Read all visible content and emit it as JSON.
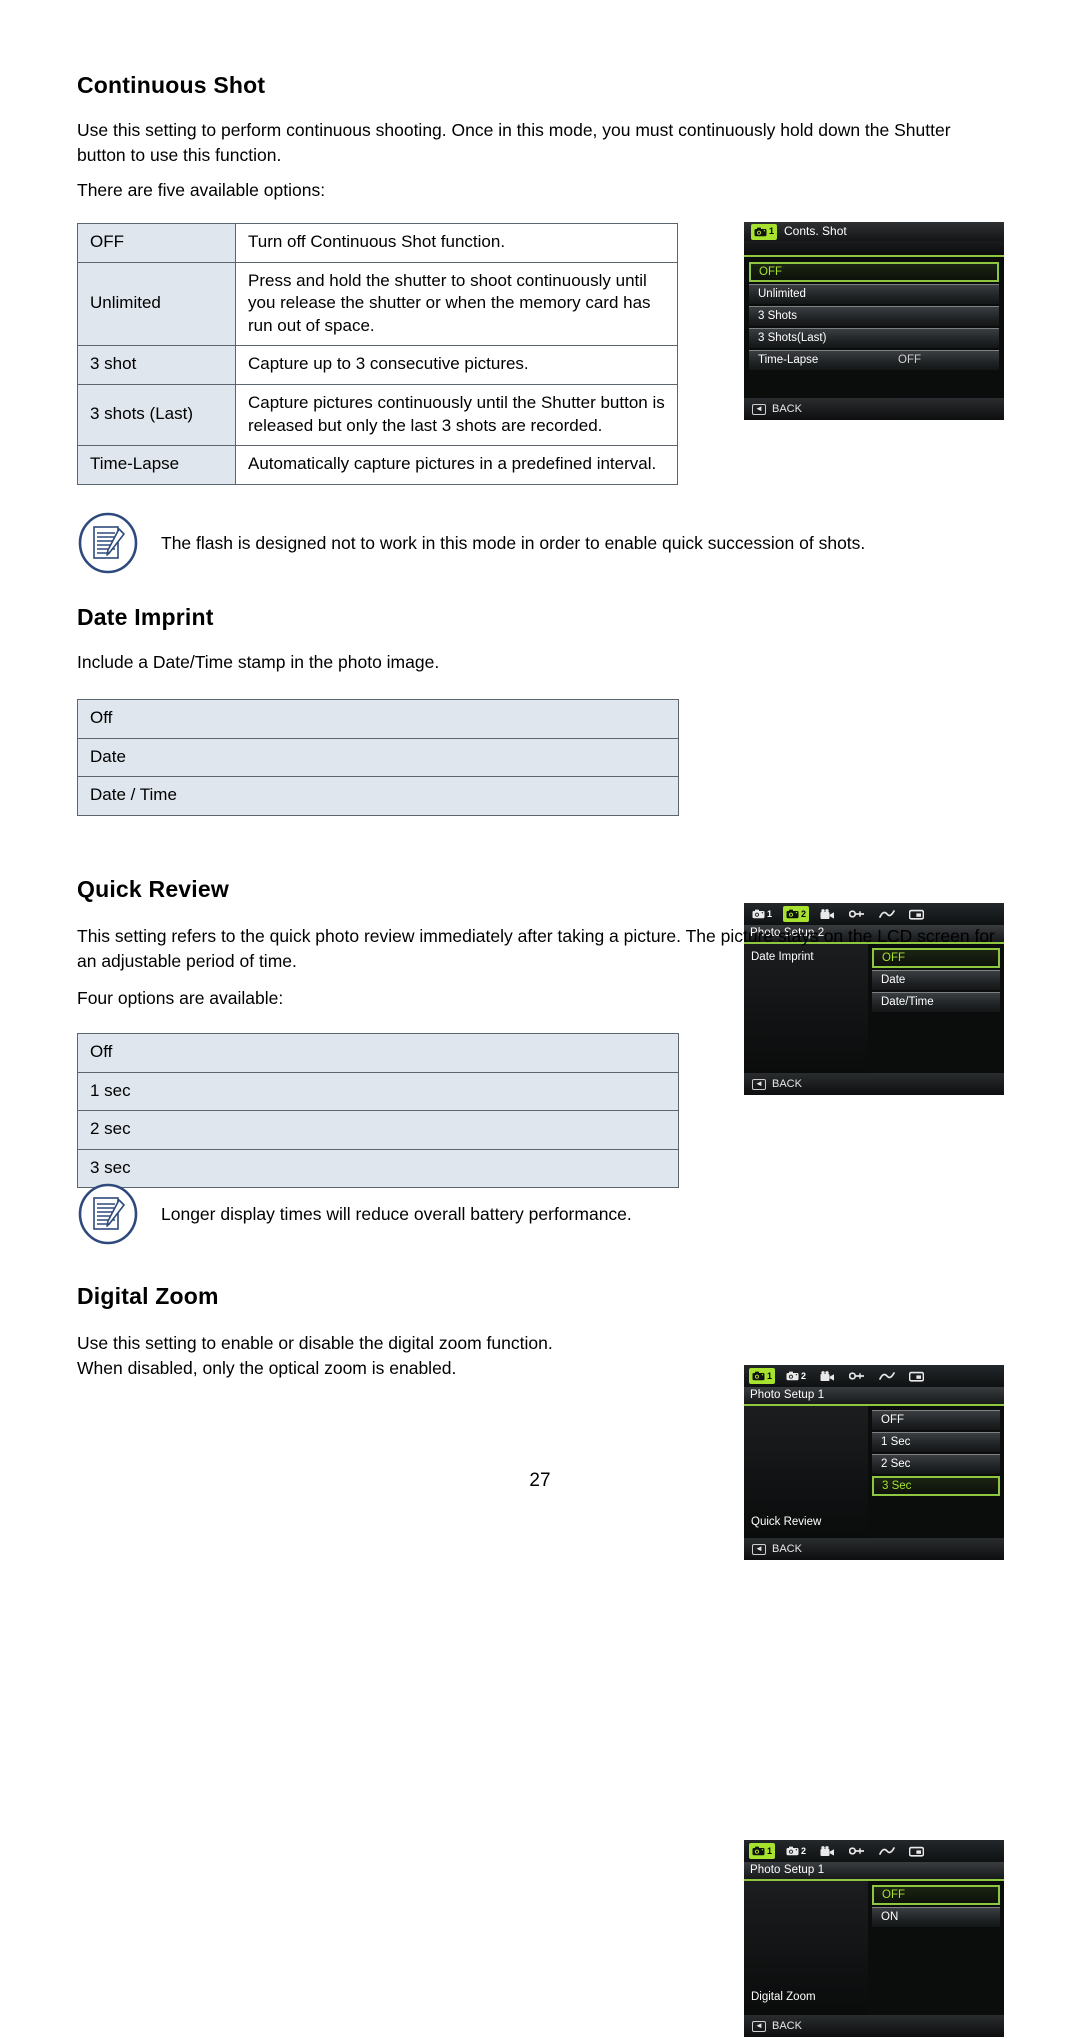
{
  "page": {
    "number": "27"
  },
  "sections": {
    "continuous_shot": {
      "title": "Continuous Shot",
      "paragraph1": "Use this setting to perform continuous shooting. Once in this mode, you must continuously hold down the Shutter button to use this function.",
      "paragraph2": "There are five available options:",
      "table": {
        "rows": [
          {
            "key": "OFF",
            "value": "Turn off Continuous Shot function."
          },
          {
            "key": "Unlimited",
            "value": "Press and hold the shutter to shoot continuously until you release the shutter or when the memory card has run out of space."
          },
          {
            "key": "3 shot",
            "value": "Capture up to 3 consecutive pictures."
          },
          {
            "key": "3 shots (Last)",
            "value": "Capture pictures continuously until the Shutter button is released but only the last 3 shots are recorded."
          },
          {
            "key": "Time-Lapse",
            "value": "Automatically capture pictures in a predefined interval."
          }
        ]
      },
      "note": "The flash is designed not to work in this mode in order to enable quick succession of shots."
    },
    "date_imprint": {
      "title": "Date Imprint",
      "paragraph1": "Include a Date/Time stamp in the photo image.",
      "table": {
        "rows": [
          "Off",
          "Date",
          "Date / Time"
        ]
      }
    },
    "quick_review": {
      "title": "Quick Review",
      "paragraph1": "This setting refers to the quick photo review immediately after taking a picture. The picture stays on the LCD screen for an adjustable period of time.",
      "paragraph2": "Four options are available:",
      "table": {
        "rows": [
          "Off",
          "1 sec",
          "2 sec",
          "3 sec"
        ]
      },
      "note": "Longer display times will reduce overall battery performance."
    },
    "digital_zoom": {
      "title": "Digital Zoom",
      "paragraph1": "Use this setting to enable or disable the digital zoom function.\nWhen disabled, only the optical zoom is enabled."
    }
  },
  "lcd_screens": {
    "conts_shot": {
      "header_tab_number": "1",
      "header_title": "Conts. Shot",
      "back_label": "BACK",
      "options": [
        {
          "label": "OFF",
          "selected": true,
          "tail": ""
        },
        {
          "label": "Unlimited",
          "selected": false,
          "tail": ""
        },
        {
          "label": "3 Shots",
          "selected": false,
          "tail": ""
        },
        {
          "label": "3 Shots(Last)",
          "selected": false,
          "tail": ""
        },
        {
          "label": "Time-Lapse",
          "selected": false,
          "tail": "OFF"
        }
      ]
    },
    "date_imprint": {
      "tabs": [
        {
          "icon": "camera-icon",
          "number": "1",
          "active": false
        },
        {
          "icon": "camera-icon",
          "number": "2",
          "active": true
        },
        {
          "icon": "movie-camera-icon",
          "number": "",
          "active": false
        },
        {
          "icon": "wrench-icon",
          "number": "",
          "active": false
        },
        {
          "icon": "curve-icon",
          "number": "",
          "active": false
        },
        {
          "icon": "playback-icon",
          "number": "",
          "active": false
        }
      ],
      "menu_title": "Photo Setup 2",
      "left_label": "Date Imprint",
      "back_label": "BACK",
      "options": [
        {
          "label": "OFF",
          "selected": true
        },
        {
          "label": "Date",
          "selected": false
        },
        {
          "label": "Date/Time",
          "selected": false
        }
      ]
    },
    "quick_review": {
      "tabs": [
        {
          "icon": "camera-icon",
          "number": "1",
          "active": true
        },
        {
          "icon": "camera-icon",
          "number": "2",
          "active": false
        },
        {
          "icon": "movie-camera-icon",
          "number": "",
          "active": false
        },
        {
          "icon": "wrench-icon",
          "number": "",
          "active": false
        },
        {
          "icon": "curve-icon",
          "number": "",
          "active": false
        },
        {
          "icon": "playback-icon",
          "number": "",
          "active": false
        }
      ],
      "menu_title": "Photo Setup 1",
      "left_label": "Quick Review",
      "back_label": "BACK",
      "options": [
        {
          "label": "OFF",
          "selected": false
        },
        {
          "label": "1 Sec",
          "selected": false
        },
        {
          "label": "2 Sec",
          "selected": false
        },
        {
          "label": "3 Sec",
          "selected": true
        }
      ]
    },
    "digital_zoom": {
      "tabs": [
        {
          "icon": "camera-icon",
          "number": "1",
          "active": true
        },
        {
          "icon": "camera-icon",
          "number": "2",
          "active": false
        },
        {
          "icon": "movie-camera-icon",
          "number": "",
          "active": false
        },
        {
          "icon": "wrench-icon",
          "number": "",
          "active": false
        },
        {
          "icon": "curve-icon",
          "number": "",
          "active": false
        },
        {
          "icon": "playback-icon",
          "number": "",
          "active": false
        }
      ],
      "menu_title": "Photo Setup 1",
      "left_label": "Digital Zoom",
      "back_label": "BACK",
      "options": [
        {
          "label": "OFF",
          "selected": true
        },
        {
          "label": "ON",
          "selected": false
        }
      ]
    }
  },
  "colors": {
    "accent_green": "#8ec63f",
    "table_key_bg": "#dfe6ee",
    "note_icon_blue": "#2e4a7d"
  }
}
